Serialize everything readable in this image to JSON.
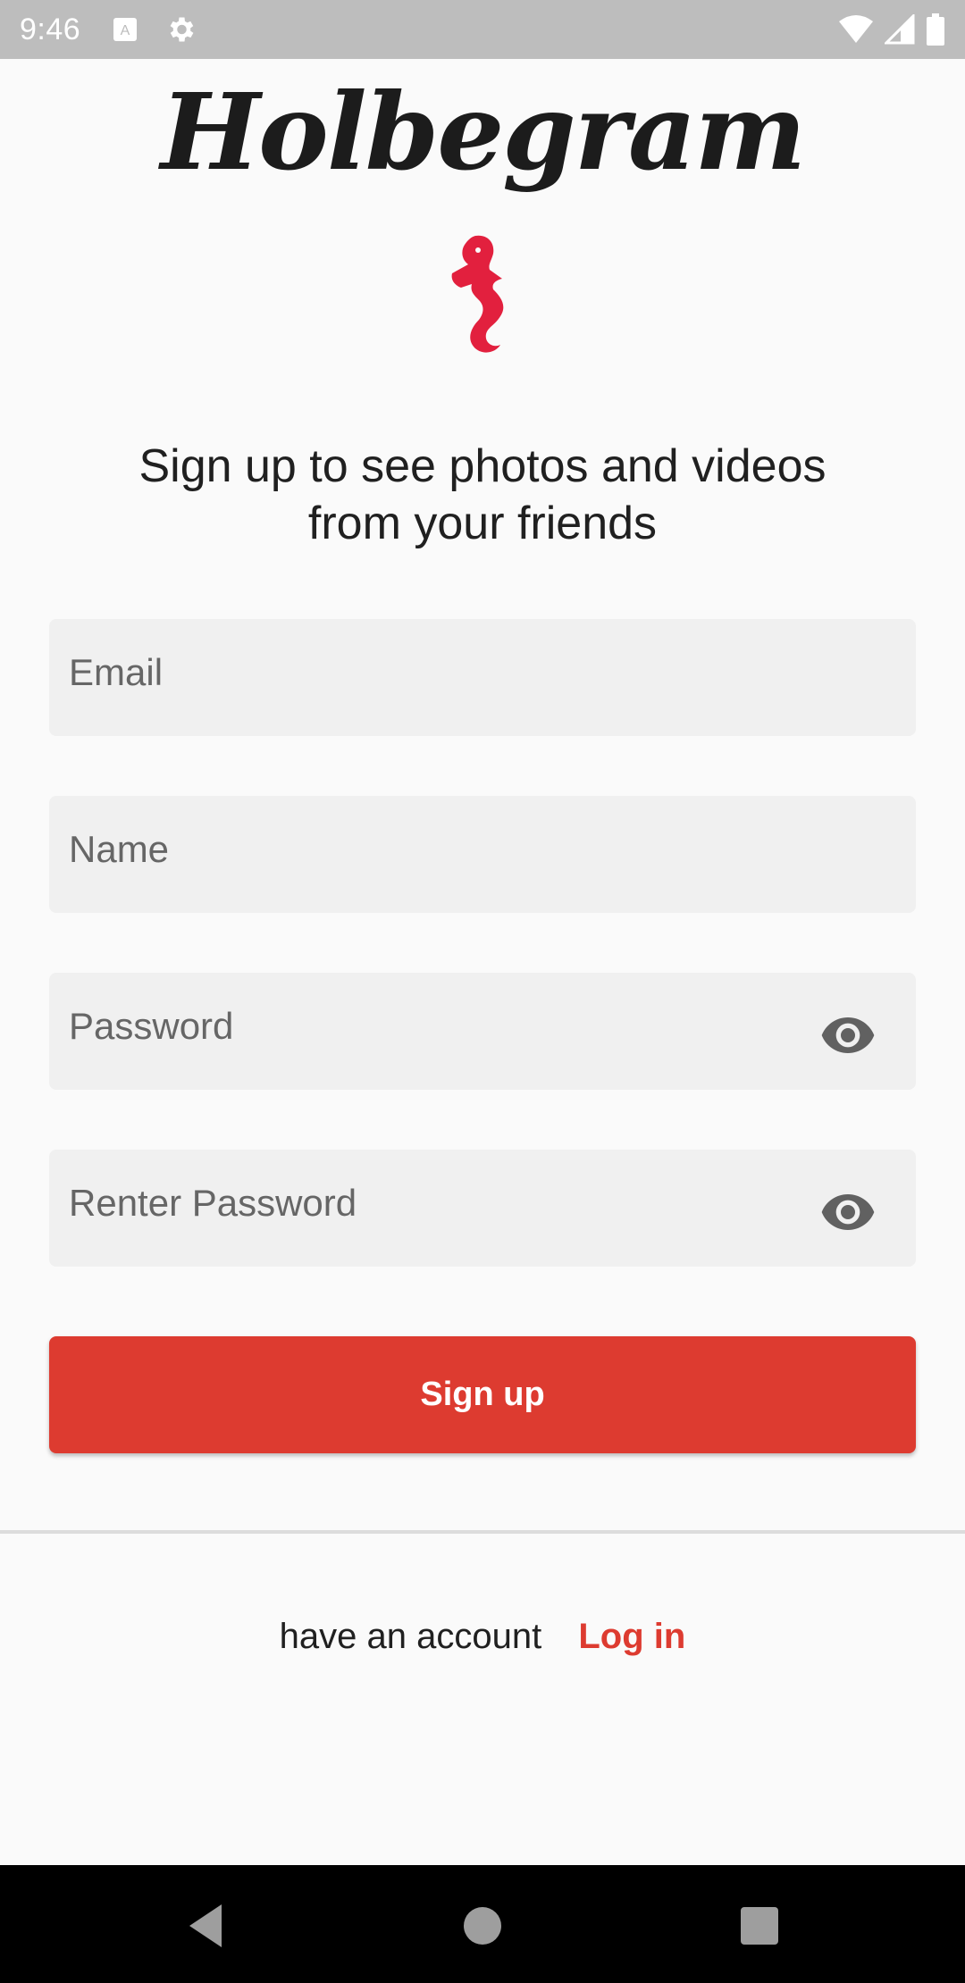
{
  "status_bar": {
    "time": "9:46",
    "icons": [
      "keyboard-a-icon",
      "settings-gear-icon",
      "wifi-icon",
      "signal-icon",
      "battery-icon"
    ]
  },
  "brand": {
    "name": "Holbegram",
    "logo_icon": "seahorse-icon",
    "logo_color": "#e2203e"
  },
  "headline": {
    "line1": "Sign up to see photos and videos",
    "line2": "from your friends"
  },
  "form": {
    "email_placeholder": "Email",
    "name_placeholder": "Name",
    "password_placeholder": "Password",
    "repassword_placeholder": "Renter Password",
    "toggle_icon": "eye-icon",
    "submit_label": "Sign up",
    "accent_color": "#dd3b30"
  },
  "footer": {
    "prompt": "have an account",
    "login_label": "Log in"
  },
  "nav_bar": {
    "icons": [
      "back-icon",
      "home-icon",
      "recents-icon"
    ]
  }
}
